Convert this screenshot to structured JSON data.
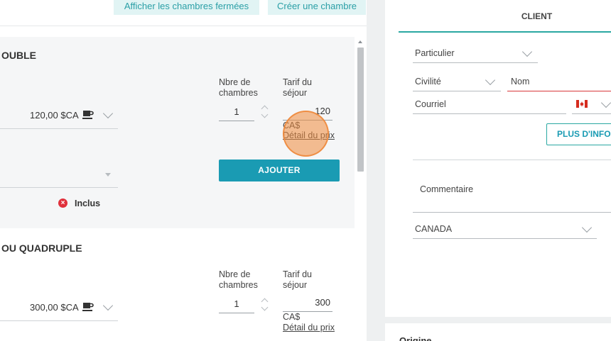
{
  "top_bar": {
    "show_closed_rooms": "Afficher les chambres fermées",
    "create_room": "Créer une chambre"
  },
  "rooms": [
    {
      "title": "OUBLE",
      "label_nb_rooms": "Nbre de chambres",
      "label_rate": "Tarif du séjour",
      "price_option": "120,00 $CA",
      "quantity": "1",
      "rate": "120",
      "currency": "CA$",
      "detail_link": "Détail du prix",
      "add_button": "AJOUTER",
      "included_label": "Inclus"
    },
    {
      "title": "OU QUADRUPLE",
      "label_nb_rooms": "Nbre de chambres",
      "label_rate": "Tarif du séjour",
      "price_option": "300,00 $CA",
      "quantity": "1",
      "rate": "300",
      "currency": "CA$",
      "detail_link": "Détail du prix"
    }
  ],
  "client": {
    "tab_label": "CLIENT",
    "type": "Particulier",
    "civility_placeholder": "Civilité",
    "name_placeholder": "Nom",
    "email_placeholder": "Courriel",
    "more_info_button": "PLUS D'INFORMATIONS",
    "comment_placeholder": "Commentaire",
    "country": "CANADA"
  },
  "origin": {
    "label": "Origine"
  },
  "icons": {
    "breakfast": "coffee-cup-icon",
    "excluded": "x-circle-icon",
    "flag": "canada-flag-icon"
  },
  "colors": {
    "accent": "#1a9bb3",
    "teal_light_bg": "#e1f4f4",
    "error": "#d8393b",
    "excluded_icon": "#e0313c"
  }
}
